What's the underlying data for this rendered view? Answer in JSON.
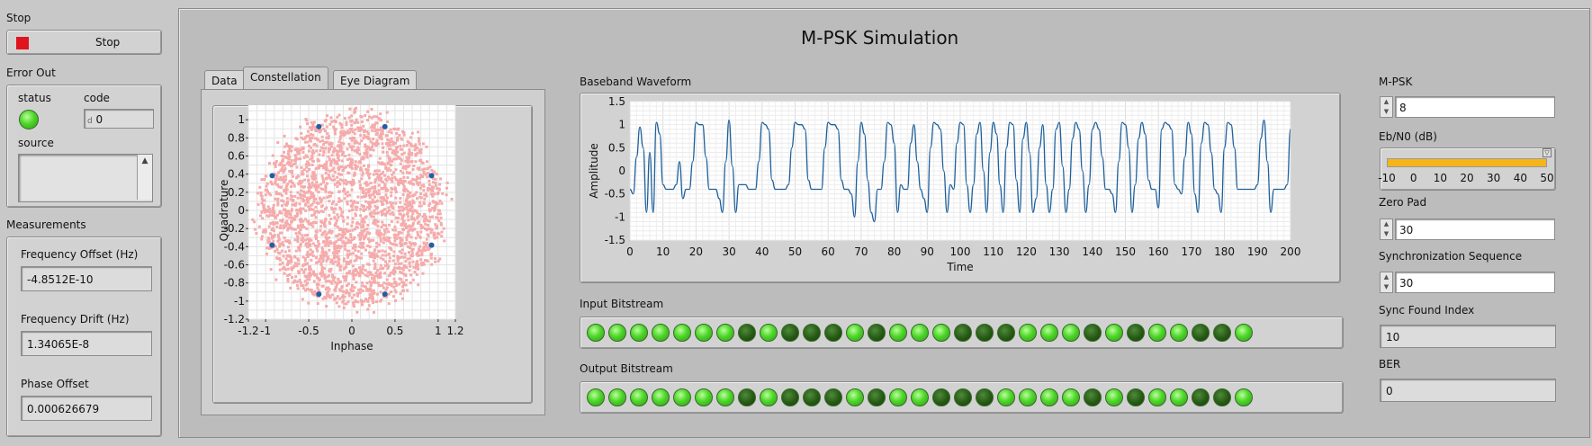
{
  "left": {
    "stop_label": "Stop",
    "stop_button": "Stop",
    "error_out_label": "Error Out",
    "status_label": "status",
    "code_label": "code",
    "code_prefix": "d",
    "code_value": "0",
    "source_label": "source",
    "measurements_label": "Measurements",
    "freq_offset_label": "Frequency Offset (Hz)",
    "freq_offset_value": "-4.8512E-10",
    "freq_drift_label": "Frequency Drift (Hz)",
    "freq_drift_value": "1.34065E-8",
    "phase_offset_label": "Phase Offset",
    "phase_offset_value": "0.000626679"
  },
  "main": {
    "title": "M-PSK Simulation",
    "tabs": [
      {
        "label": "Data"
      },
      {
        "label": "Constellation"
      },
      {
        "label": "Eye Diagram"
      }
    ],
    "input_bitstream_label": "Input Bitstream",
    "output_bitstream_label": "Output Bitstream",
    "input_bits": [
      1,
      1,
      1,
      1,
      1,
      1,
      1,
      0,
      1,
      0,
      0,
      0,
      1,
      0,
      1,
      1,
      1,
      0,
      0,
      0,
      1,
      1,
      1,
      0,
      1,
      0,
      1,
      1,
      0,
      0,
      1
    ],
    "output_bits": [
      1,
      1,
      1,
      1,
      1,
      1,
      1,
      0,
      1,
      0,
      0,
      0,
      1,
      0,
      1,
      1,
      0,
      0,
      0,
      1,
      1,
      1,
      1,
      0,
      1,
      0,
      1,
      1,
      0,
      0,
      1
    ]
  },
  "right": {
    "mpsk_label": "M-PSK",
    "mpsk_value": "8",
    "ebn0_label": "Eb/N0 (dB)",
    "ebn0_ticks": [
      "-10",
      "0",
      "10",
      "20",
      "30",
      "40",
      "50"
    ],
    "ebn0_value": 50,
    "zero_pad_label": "Zero Pad",
    "zero_pad_value": "30",
    "sync_seq_label": "Synchronization Sequence",
    "sync_seq_value": "30",
    "sync_found_label": "Sync Found Index",
    "sync_found_value": "10",
    "ber_label": "BER",
    "ber_value": "0"
  },
  "colors": {
    "led_on": "#4ed62a",
    "led_off": "#255a14",
    "constellation_cloud": "#f6a3a3",
    "constellation_points": "#1f5fa8",
    "waveform_line": "#1c5f9c",
    "slider_fill": "#f4b41a",
    "stop_icon": "#e0141e",
    "status_led": "#4ed62a"
  },
  "chart_data": [
    {
      "type": "scatter",
      "xlabel": "Inphase",
      "ylabel": "Quadrature",
      "xlim": [
        -1.2,
        1.2
      ],
      "ylim": [
        -1.2,
        1.2
      ],
      "x_ticks": [
        "-1.2",
        "-1",
        "-0.5",
        "0",
        "0.5",
        "1",
        "1.2"
      ],
      "y_ticks": [
        "1.2",
        "1",
        "0.8",
        "0.6",
        "0.4",
        "0.2",
        "0",
        "-0.2",
        "-0.4",
        "-0.6",
        "-0.8",
        "-1",
        "-1.2"
      ],
      "grid": true,
      "ideal_points": [
        [
          0.383,
          0.924
        ],
        [
          -0.383,
          0.924
        ],
        [
          0.924,
          0.383
        ],
        [
          -0.924,
          0.383
        ],
        [
          0.924,
          -0.383
        ],
        [
          -0.924,
          -0.383
        ],
        [
          0.383,
          -0.924
        ],
        [
          -0.383,
          -0.924
        ]
      ]
    },
    {
      "type": "line",
      "title": "Baseband Waveform",
      "xlabel": "Time",
      "ylabel": "Amplitude",
      "xlim": [
        0,
        200
      ],
      "ylim": [
        -1.5,
        1.5
      ],
      "x_ticks": [
        "0",
        "10",
        "20",
        "30",
        "40",
        "50",
        "60",
        "70",
        "80",
        "90",
        "100",
        "110",
        "120",
        "130",
        "140",
        "150",
        "160",
        "170",
        "180",
        "190",
        "200"
      ],
      "y_ticks": [
        "1.5",
        "1",
        "0.5",
        "0",
        "-0.5",
        "-1",
        "-1.5"
      ],
      "grid": true,
      "x": [
        0,
        1,
        2,
        3,
        4,
        5,
        6,
        7,
        8,
        9,
        10,
        11,
        12,
        13,
        14,
        15,
        16,
        17,
        18,
        19,
        20,
        21,
        22,
        23,
        24,
        25,
        26,
        27,
        28,
        29,
        30,
        31,
        32,
        33,
        34,
        35,
        36,
        37,
        38,
        39,
        40,
        41,
        42,
        43,
        44,
        45,
        46,
        47,
        48,
        49,
        50,
        51,
        52,
        53,
        54,
        55,
        56,
        57,
        58,
        59,
        60,
        61,
        62,
        63,
        64,
        65,
        66,
        67,
        68,
        69,
        70,
        71,
        72,
        73,
        74,
        75,
        76,
        77,
        78,
        79,
        80,
        81,
        82,
        83,
        84,
        85,
        86,
        87,
        88,
        89,
        90,
        91,
        92,
        93,
        94,
        95,
        96,
        97,
        98,
        99,
        100,
        101,
        102,
        103,
        104,
        105,
        106,
        107,
        108,
        109,
        110,
        111,
        112,
        113,
        114,
        115,
        116,
        117,
        118,
        119,
        120,
        121,
        122,
        123,
        124,
        125,
        126,
        127,
        128,
        129,
        130,
        131,
        132,
        133,
        134,
        135,
        136,
        137,
        138,
        139,
        140,
        141,
        142,
        143,
        144,
        145,
        146,
        147,
        148,
        149,
        150,
        151,
        152,
        153,
        154,
        155,
        156,
        157,
        158,
        159,
        160,
        161,
        162,
        163,
        164,
        165,
        166,
        167,
        168,
        169,
        170,
        171,
        172,
        173,
        174,
        175,
        176,
        177,
        178,
        179,
        180,
        181,
        182,
        183,
        184,
        185,
        186,
        187,
        188,
        189,
        190,
        191,
        192,
        193,
        194,
        195,
        196,
        197,
        198,
        199,
        200
      ],
      "y": [
        -0.4,
        -0.5,
        0.3,
        0.95,
        0.5,
        -0.9,
        0.4,
        -0.9,
        1.05,
        0.8,
        -0.3,
        -0.4,
        -0.4,
        -0.4,
        -0.3,
        0.2,
        -0.6,
        -0.4,
        -0.4,
        0.2,
        1.05,
        1.0,
        1.0,
        0.3,
        -0.4,
        -0.4,
        -0.4,
        -0.6,
        -0.9,
        0.2,
        1.1,
        0.1,
        -0.9,
        -0.3,
        -0.3,
        -0.3,
        -0.4,
        -0.4,
        -0.4,
        0.2,
        1.05,
        1.0,
        0.9,
        -0.2,
        -0.4,
        -0.4,
        -0.4,
        -0.4,
        -0.3,
        0.5,
        1.05,
        1.0,
        1.0,
        0.9,
        -0.2,
        -0.4,
        -0.4,
        -0.4,
        -0.4,
        0.5,
        1.05,
        1.0,
        1.0,
        0.9,
        -0.2,
        -0.4,
        -0.4,
        -0.5,
        -1.0,
        0.2,
        1.05,
        0.8,
        -0.2,
        -0.9,
        -1.1,
        -0.4,
        -0.4,
        0.2,
        1.05,
        1.0,
        0.6,
        -0.9,
        -0.3,
        -0.4,
        -0.4,
        0.6,
        1.0,
        0.2,
        -0.4,
        -0.6,
        -0.9,
        0.5,
        1.05,
        1.0,
        0.9,
        0.0,
        -0.9,
        -0.3,
        -0.4,
        0.6,
        1.05,
        1.0,
        -0.3,
        -0.9,
        -0.3,
        0.8,
        1.05,
        0.0,
        -0.9,
        0.4,
        1.05,
        0.8,
        -0.3,
        -0.9,
        0.5,
        1.05,
        1.0,
        -0.2,
        -0.9,
        0.7,
        1.05,
        0.4,
        -0.9,
        -0.6,
        0.5,
        1.0,
        -0.3,
        -0.9,
        -0.4,
        0.9,
        1.05,
        0.1,
        -0.9,
        -0.4,
        0.7,
        1.05,
        0.9,
        0.0,
        -0.9,
        -0.3,
        0.9,
        1.05,
        0.9,
        0.3,
        -0.4,
        -0.4,
        -0.5,
        -0.9,
        0.2,
        1.05,
        1.0,
        0.5,
        -0.9,
        -0.3,
        0.7,
        1.05,
        0.8,
        -0.2,
        -0.4,
        -0.4,
        -0.8,
        0.9,
        1.05,
        1.0,
        0.9,
        -0.3,
        -0.4,
        -0.5,
        0.3,
        1.05,
        0.8,
        -0.5,
        -0.9,
        0.6,
        1.05,
        1.0,
        0.4,
        -0.4,
        -0.5,
        -0.9,
        0.5,
        1.05,
        1.0,
        0.5,
        -0.4,
        -0.4,
        -0.4,
        -0.4,
        -0.4,
        -0.4,
        -0.3,
        0.7,
        1.1,
        0.2,
        -0.9,
        -0.4,
        -0.4,
        -0.4,
        -0.4,
        -0.3,
        0.9
      ]
    }
  ]
}
